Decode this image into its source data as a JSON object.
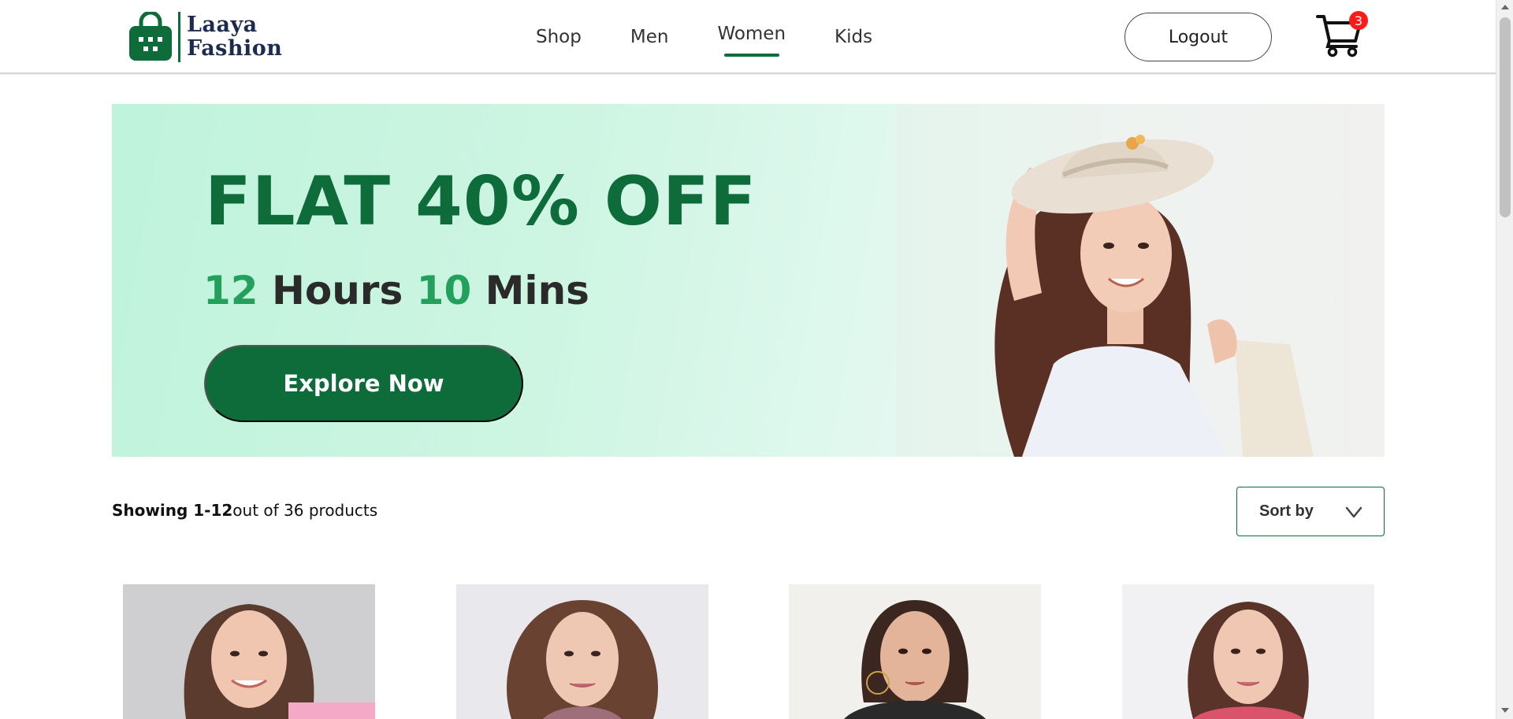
{
  "brand": {
    "line1": "Laaya",
    "line2": "Fashion",
    "color": "#0e6b3a"
  },
  "nav": {
    "items": [
      {
        "label": "Shop"
      },
      {
        "label": "Men"
      },
      {
        "label": "Women",
        "active": true
      },
      {
        "label": "Kids"
      }
    ]
  },
  "header": {
    "logout_label": "Logout",
    "cart_count": "3"
  },
  "banner": {
    "headline": "FLAT 40% OFF",
    "hours_value": "12",
    "hours_label": "Hours",
    "mins_value": "10",
    "mins_label": "Mins",
    "cta_label": "Explore Now",
    "accent": "#23a15c"
  },
  "results": {
    "range_label": "Showing 1-12",
    "total_label": "out of 36 products"
  },
  "sort": {
    "label": "Sort by"
  },
  "products": [
    {
      "icon": "product-image-woman-pink-top"
    },
    {
      "icon": "product-image-woman-wavy-hair"
    },
    {
      "icon": "product-image-woman-floral-print"
    },
    {
      "icon": "product-image-woman-red-print"
    }
  ]
}
